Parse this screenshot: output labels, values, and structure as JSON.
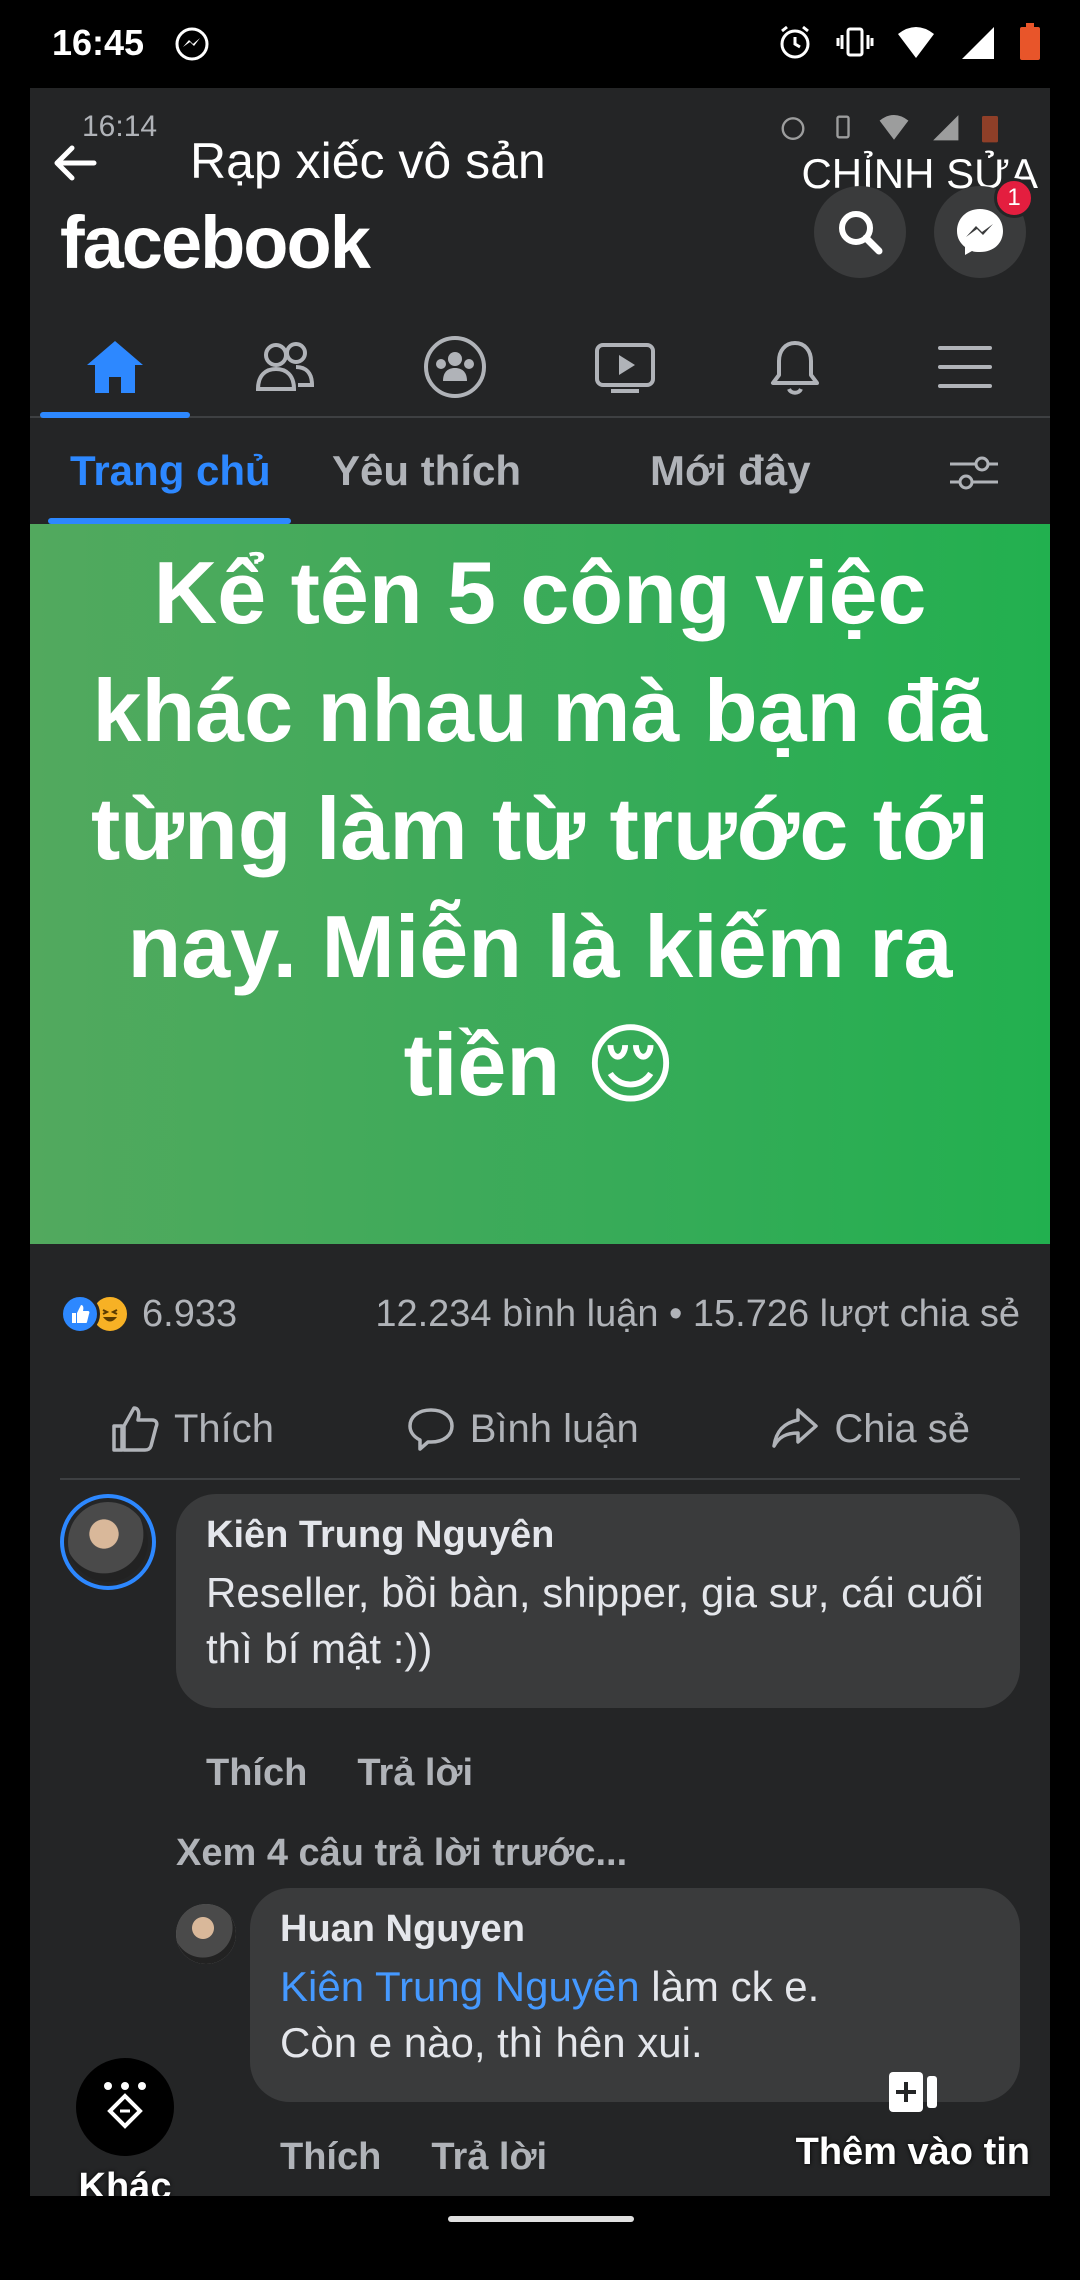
{
  "status_bar": {
    "time": "16:45"
  },
  "inner_status": {
    "time": "16:14"
  },
  "story_editor": {
    "title": "Rạp xiếc vô sản",
    "edit_label": "CHỈNH SỬA"
  },
  "app": {
    "logo": "facebook",
    "messenger_badge": "1"
  },
  "nav_icons": [
    "home-icon",
    "friends-icon",
    "groups-icon",
    "watch-icon",
    "notifications-icon",
    "menu-icon"
  ],
  "sub_tabs": [
    {
      "label": "Trang chủ",
      "active": true
    },
    {
      "label": "Yêu thích",
      "active": false
    },
    {
      "label": "Mới đây",
      "active": false
    }
  ],
  "post": {
    "banner_text": "Kể tên 5 công việc khác nhau mà bạn đã từng làm từ trước tới nay. Miễn là kiếm ra tiền 😌",
    "reaction_count": "6.933",
    "stats": "12.234 bình luận • 15.726 lượt chia sẻ",
    "actions": {
      "like": "Thích",
      "comment": "Bình luận",
      "share": "Chia sẻ"
    },
    "accent_color": "#2d88ff",
    "banner_color": "#36ab58"
  },
  "comments": [
    {
      "author": "Kiên Trung Nguyên",
      "text": "Reseller, bồi bàn, shipper, gia sư, cái cuối thì bí mật :))",
      "like_label": "Thích",
      "reply_label": "Trả lời"
    }
  ],
  "previous_replies": "Xem 4 câu trả lời trước...",
  "reply": {
    "author": "Huan Nguyen",
    "mention": "Kiên Trung Nguyên",
    "text_after_mention": " làm ck e.",
    "text_line2": "Còn e nào, thì hên xui.",
    "like_label": "Thích",
    "reply_label": "Trả lời"
  },
  "overlay": {
    "more_label": "Khác",
    "add_to_story_label": "Thêm vào tin"
  }
}
